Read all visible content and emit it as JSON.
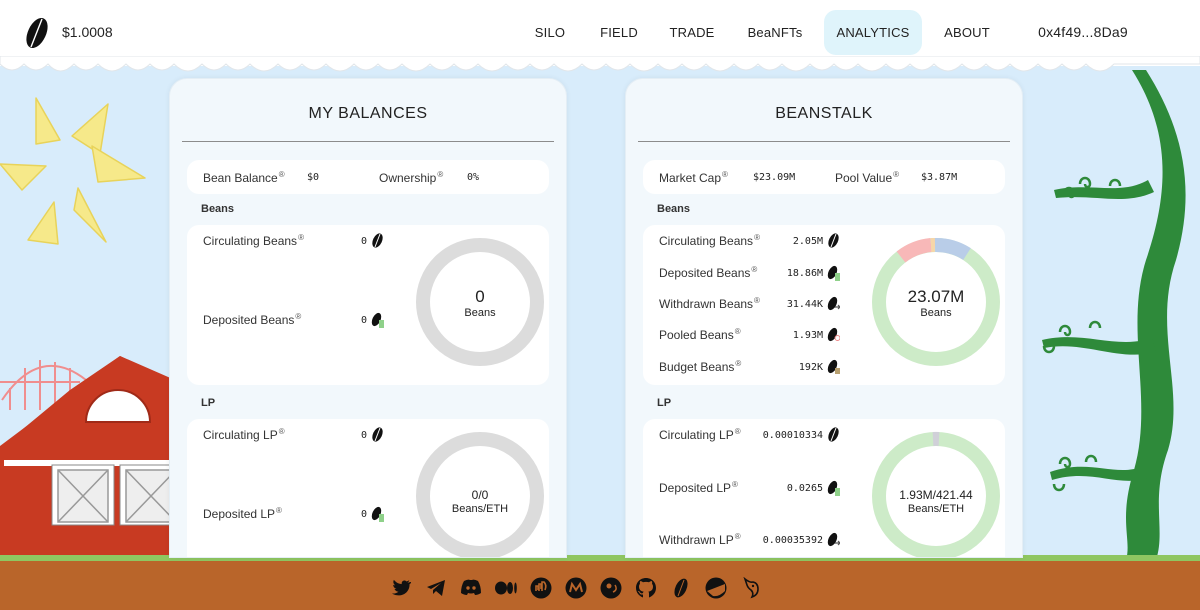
{
  "nav": {
    "price": "$1.0008",
    "items": [
      {
        "label": "SILO"
      },
      {
        "label": "FIELD"
      },
      {
        "label": "TRADE"
      },
      {
        "label": "BeaNFTs"
      },
      {
        "label": "ANALYTICS"
      },
      {
        "label": "ABOUT"
      }
    ],
    "wallet": "0x4f49...8Da9",
    "active_item": "ANALYTICS"
  },
  "my_balances": {
    "title": "MY BALANCES",
    "summary": {
      "bean_balance_label": "Bean Balance",
      "bean_balance_value": "$0",
      "ownership_label": "Ownership",
      "ownership_value": "0%"
    },
    "beans_section": "Beans",
    "beans_rows": [
      {
        "label": "Circulating Beans",
        "value": "0"
      },
      {
        "label": "Deposited Beans",
        "value": "0"
      }
    ],
    "beans_donut": {
      "value": "0",
      "unit": "Beans"
    },
    "lp_section": "LP",
    "lp_rows": [
      {
        "label": "Circulating LP",
        "value": "0"
      },
      {
        "label": "Deposited LP",
        "value": "0"
      }
    ],
    "lp_donut": {
      "value": "0/0",
      "unit": "Beans/ETH"
    }
  },
  "beanstalk": {
    "title": "BEANSTALK",
    "summary": {
      "market_cap_label": "Market Cap",
      "market_cap_value": "$23.09M",
      "pool_value_label": "Pool Value",
      "pool_value_value": "$3.87M"
    },
    "beans_section": "Beans",
    "beans_rows": [
      {
        "label": "Circulating Beans",
        "value": "2.05M"
      },
      {
        "label": "Deposited Beans",
        "value": "18.86M"
      },
      {
        "label": "Withdrawn Beans",
        "value": "31.44K"
      },
      {
        "label": "Pooled Beans",
        "value": "1.93M"
      },
      {
        "label": "Budget Beans",
        "value": "192K"
      }
    ],
    "beans_donut": {
      "value": "23.07M",
      "unit": "Beans"
    },
    "lp_section": "LP",
    "lp_rows": [
      {
        "label": "Circulating LP",
        "value": "0.00010334"
      },
      {
        "label": "Deposited LP",
        "value": "0.0265"
      },
      {
        "label": "Withdrawn LP",
        "value": "0.00035392"
      }
    ],
    "lp_donut": {
      "value": "1.93M/421.44",
      "unit": "Beans/ETH"
    }
  },
  "footer": {
    "icons": [
      "twitter-icon",
      "telegram-icon",
      "discord-icon",
      "medium-icon",
      "etherscan-icon",
      "coingecko-icon",
      "github-icon",
      "beanstalk-icon",
      "dune-icon",
      "uniswap-icon"
    ]
  },
  "colors": {
    "donut_empty": "#dcdcdc",
    "donut_green": "#cdebc8",
    "donut_red": "#f8b8b8",
    "donut_blue": "#b9cde8",
    "ground": "#b9652a",
    "grass": "#8fc661",
    "sky": "#d8ecfb",
    "sun": "#f6e98a",
    "barn_red": "#c83a22",
    "stalk": "#2e8a3a"
  }
}
